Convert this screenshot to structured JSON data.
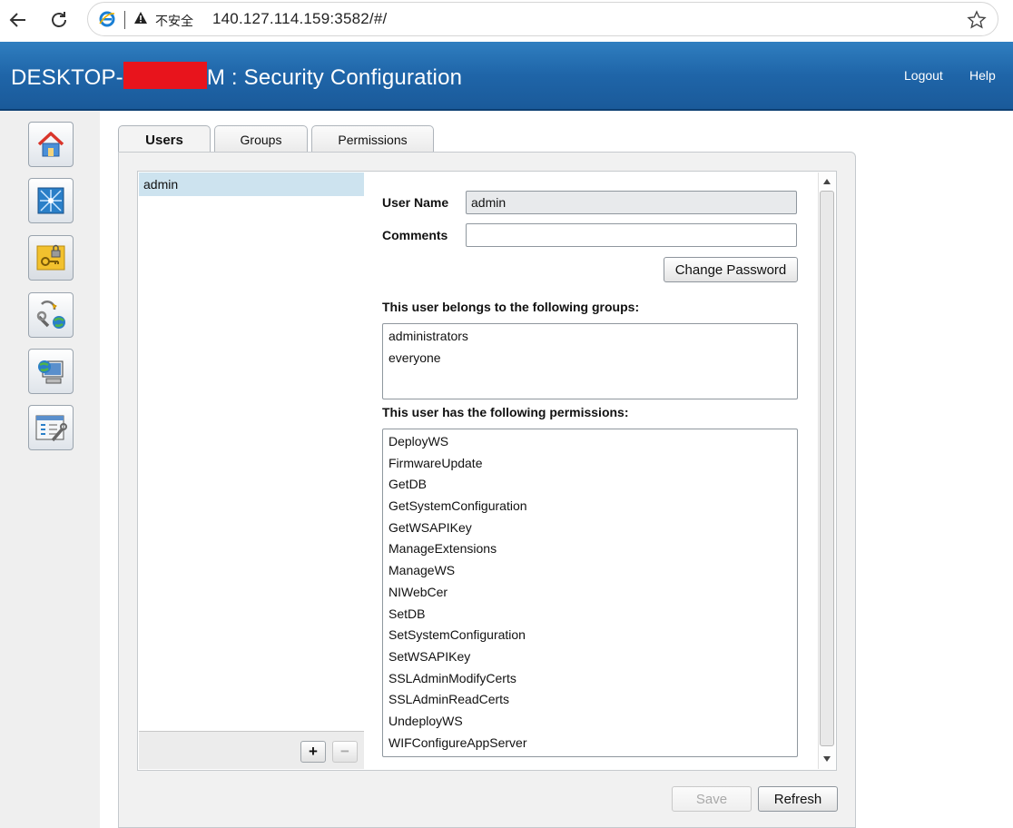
{
  "browser": {
    "insecure_label": "不安全",
    "url": "140.127.114.159:3582/#/"
  },
  "header": {
    "title_prefix": "DESKTOP-",
    "title_suffix": "M : Security Configuration",
    "logout": "Logout",
    "help": "Help",
    "color": "#1f65a8"
  },
  "sidebar": {
    "items": [
      {
        "icon": "home-icon"
      },
      {
        "icon": "network-icon"
      },
      {
        "icon": "security-lock-icon"
      },
      {
        "icon": "web-services-icon"
      },
      {
        "icon": "remote-computer-icon"
      },
      {
        "icon": "configuration-tools-icon"
      }
    ]
  },
  "tabs": [
    "Users",
    "Groups",
    "Permissions"
  ],
  "users": [
    "admin"
  ],
  "form": {
    "username_label": "User Name",
    "username_value": "admin",
    "comments_label": "Comments",
    "comments_value": "",
    "change_password": "Change Password",
    "groups_heading": "This user belongs to the following groups:",
    "groups": [
      "administrators",
      "everyone"
    ],
    "permissions_heading": "This user has the following permissions:",
    "permissions": [
      "DeployWS",
      "FirmwareUpdate",
      "GetDB",
      "GetSystemConfiguration",
      "GetWSAPIKey",
      "ManageExtensions",
      "ManageWS",
      "NIWebCer",
      "SetDB",
      "SetSystemConfiguration",
      "SetWSAPIKey",
      "SSLAdminModifyCerts",
      "SSLAdminReadCerts",
      "UndeployWS",
      "WIFConfigureAppServer"
    ]
  },
  "list_buttons": {
    "add": "+",
    "remove": "−"
  },
  "footer": {
    "save": "Save",
    "refresh": "Refresh"
  }
}
